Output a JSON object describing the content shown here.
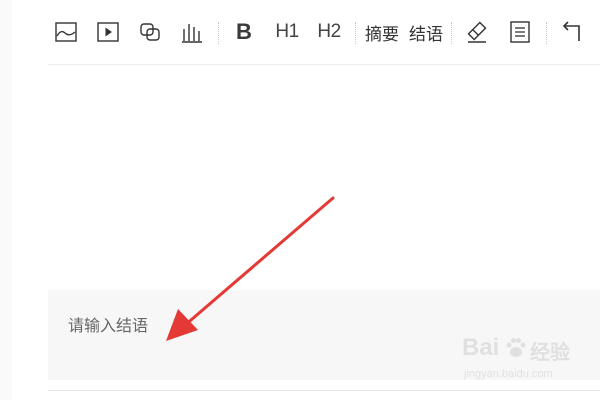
{
  "toolbar": {
    "buttons": [
      {
        "name": "image-icon",
        "label": ""
      },
      {
        "name": "video-icon",
        "label": ""
      },
      {
        "name": "link-icon",
        "label": ""
      },
      {
        "name": "chart-icon",
        "label": ""
      },
      {
        "name": "bold-button",
        "label": "B"
      },
      {
        "name": "heading1-button",
        "label": "H1"
      },
      {
        "name": "heading2-button",
        "label": "H2"
      },
      {
        "name": "summary-button",
        "label": "摘要"
      },
      {
        "name": "conclusion-button",
        "label": "结语"
      },
      {
        "name": "eraser-icon",
        "label": ""
      },
      {
        "name": "paragraph-icon",
        "label": ""
      },
      {
        "name": "undo-icon",
        "label": ""
      }
    ]
  },
  "editor": {
    "body_text": "",
    "conclusion_placeholder": "请输入结语"
  },
  "annotation": {
    "arrow_color": "#e53935"
  },
  "watermark": {
    "brand": "Bai",
    "brand_suffix": "经验",
    "url": "jingyan.baidu.com"
  },
  "colors": {
    "toolbar_icon": "#333333",
    "conclusion_background": "#f7f7f7",
    "placeholder_text": "#666666"
  }
}
